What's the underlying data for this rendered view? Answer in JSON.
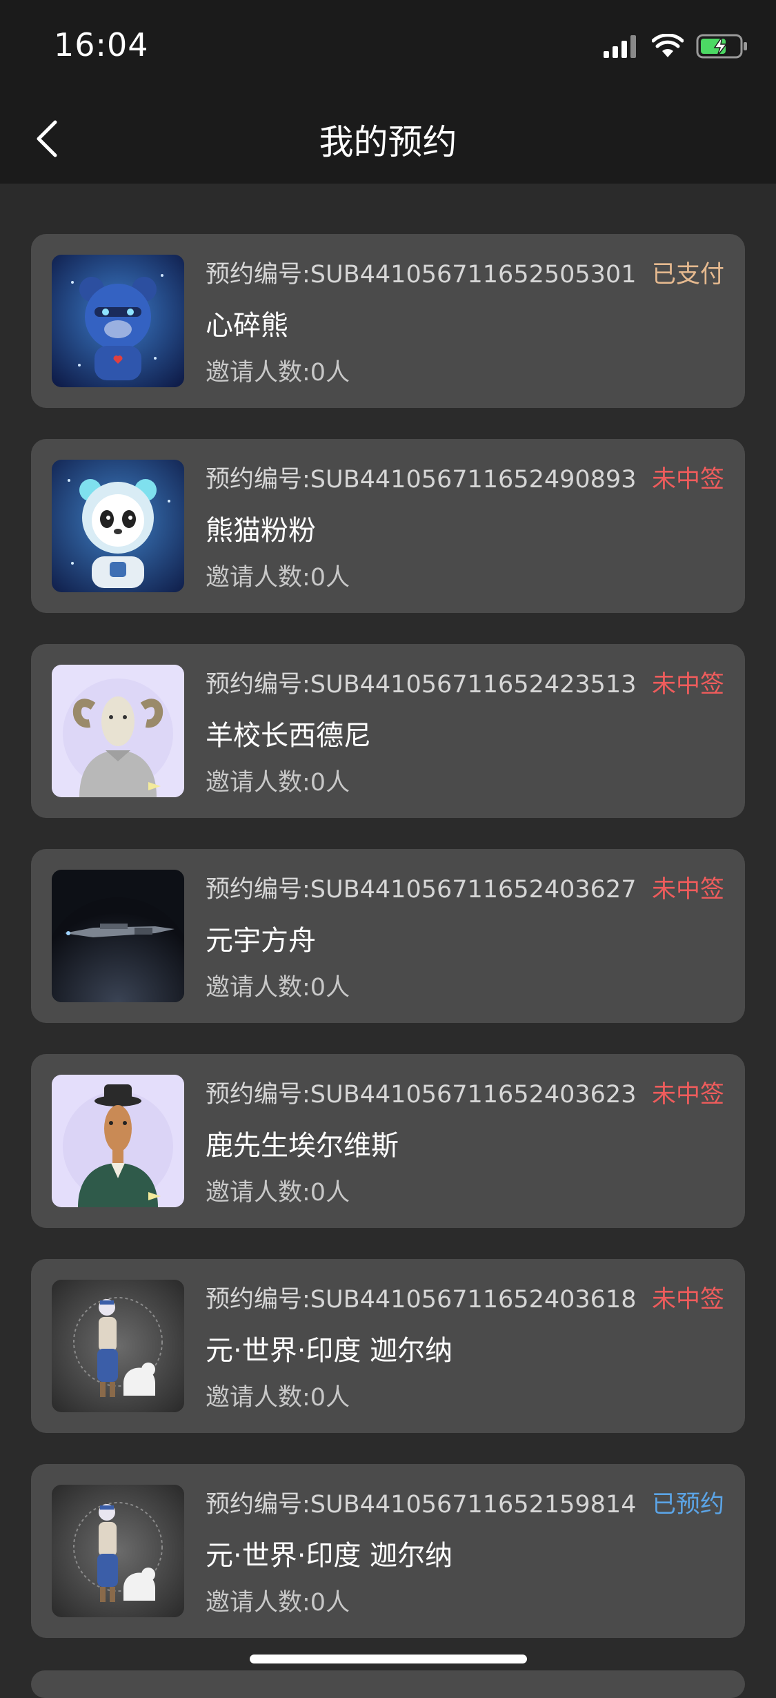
{
  "status_bar": {
    "time": "16:04",
    "icons": [
      "signal-icon",
      "wifi-icon",
      "battery-charging-icon"
    ]
  },
  "nav": {
    "back_icon": "chevron-left-icon",
    "title": "我的预约"
  },
  "colors": {
    "paid": "#e5b98f",
    "not_won": "#ef5c5c",
    "reserved": "#5ba4e6",
    "card_bg": "#4b4b4b",
    "page_bg": "#2b2b2b",
    "bar_bg": "#1b1b1b"
  },
  "reservations": [
    {
      "order_label": "预约编号:",
      "order_no": "SUB441056711652505301",
      "status": "已支付",
      "status_kind": "paid",
      "name": "心碎熊",
      "invite_label": "邀请人数:",
      "invite_count": "0人",
      "thumb_icon": "robot-bear-image"
    },
    {
      "order_label": "预约编号:",
      "order_no": "SUB441056711652490893",
      "status": "未中签",
      "status_kind": "not_won",
      "name": "熊猫粉粉",
      "invite_label": "邀请人数:",
      "invite_count": "0人",
      "thumb_icon": "panda-astronaut-image"
    },
    {
      "order_label": "预约编号:",
      "order_no": "SUB441056711652423513",
      "status": "未中签",
      "status_kind": "not_won",
      "name": "羊校长西德尼",
      "invite_label": "邀请人数:",
      "invite_count": "0人",
      "thumb_icon": "ram-portrait-image"
    },
    {
      "order_label": "预约编号:",
      "order_no": "SUB441056711652403627",
      "status": "未中签",
      "status_kind": "not_won",
      "name": "元宇方舟",
      "invite_label": "邀请人数:",
      "invite_count": "0人",
      "thumb_icon": "spaceship-image"
    },
    {
      "order_label": "预约编号:",
      "order_no": "SUB441056711652403623",
      "status": "未中签",
      "status_kind": "not_won",
      "name": "鹿先生埃尔维斯",
      "invite_label": "邀请人数:",
      "invite_count": "0人",
      "thumb_icon": "deer-gentleman-image"
    },
    {
      "order_label": "预约编号:",
      "order_no": "SUB441056711652403618",
      "status": "未中签",
      "status_kind": "not_won",
      "name": "元·世界·印度 迦尔纳",
      "invite_label": "邀请人数:",
      "invite_count": "0人",
      "thumb_icon": "indian-warrior-image"
    },
    {
      "order_label": "预约编号:",
      "order_no": "SUB441056711652159814",
      "status": "已预约",
      "status_kind": "reserved",
      "name": "元·世界·印度 迦尔纳",
      "invite_label": "邀请人数:",
      "invite_count": "0人",
      "thumb_icon": "indian-warrior-image"
    }
  ]
}
